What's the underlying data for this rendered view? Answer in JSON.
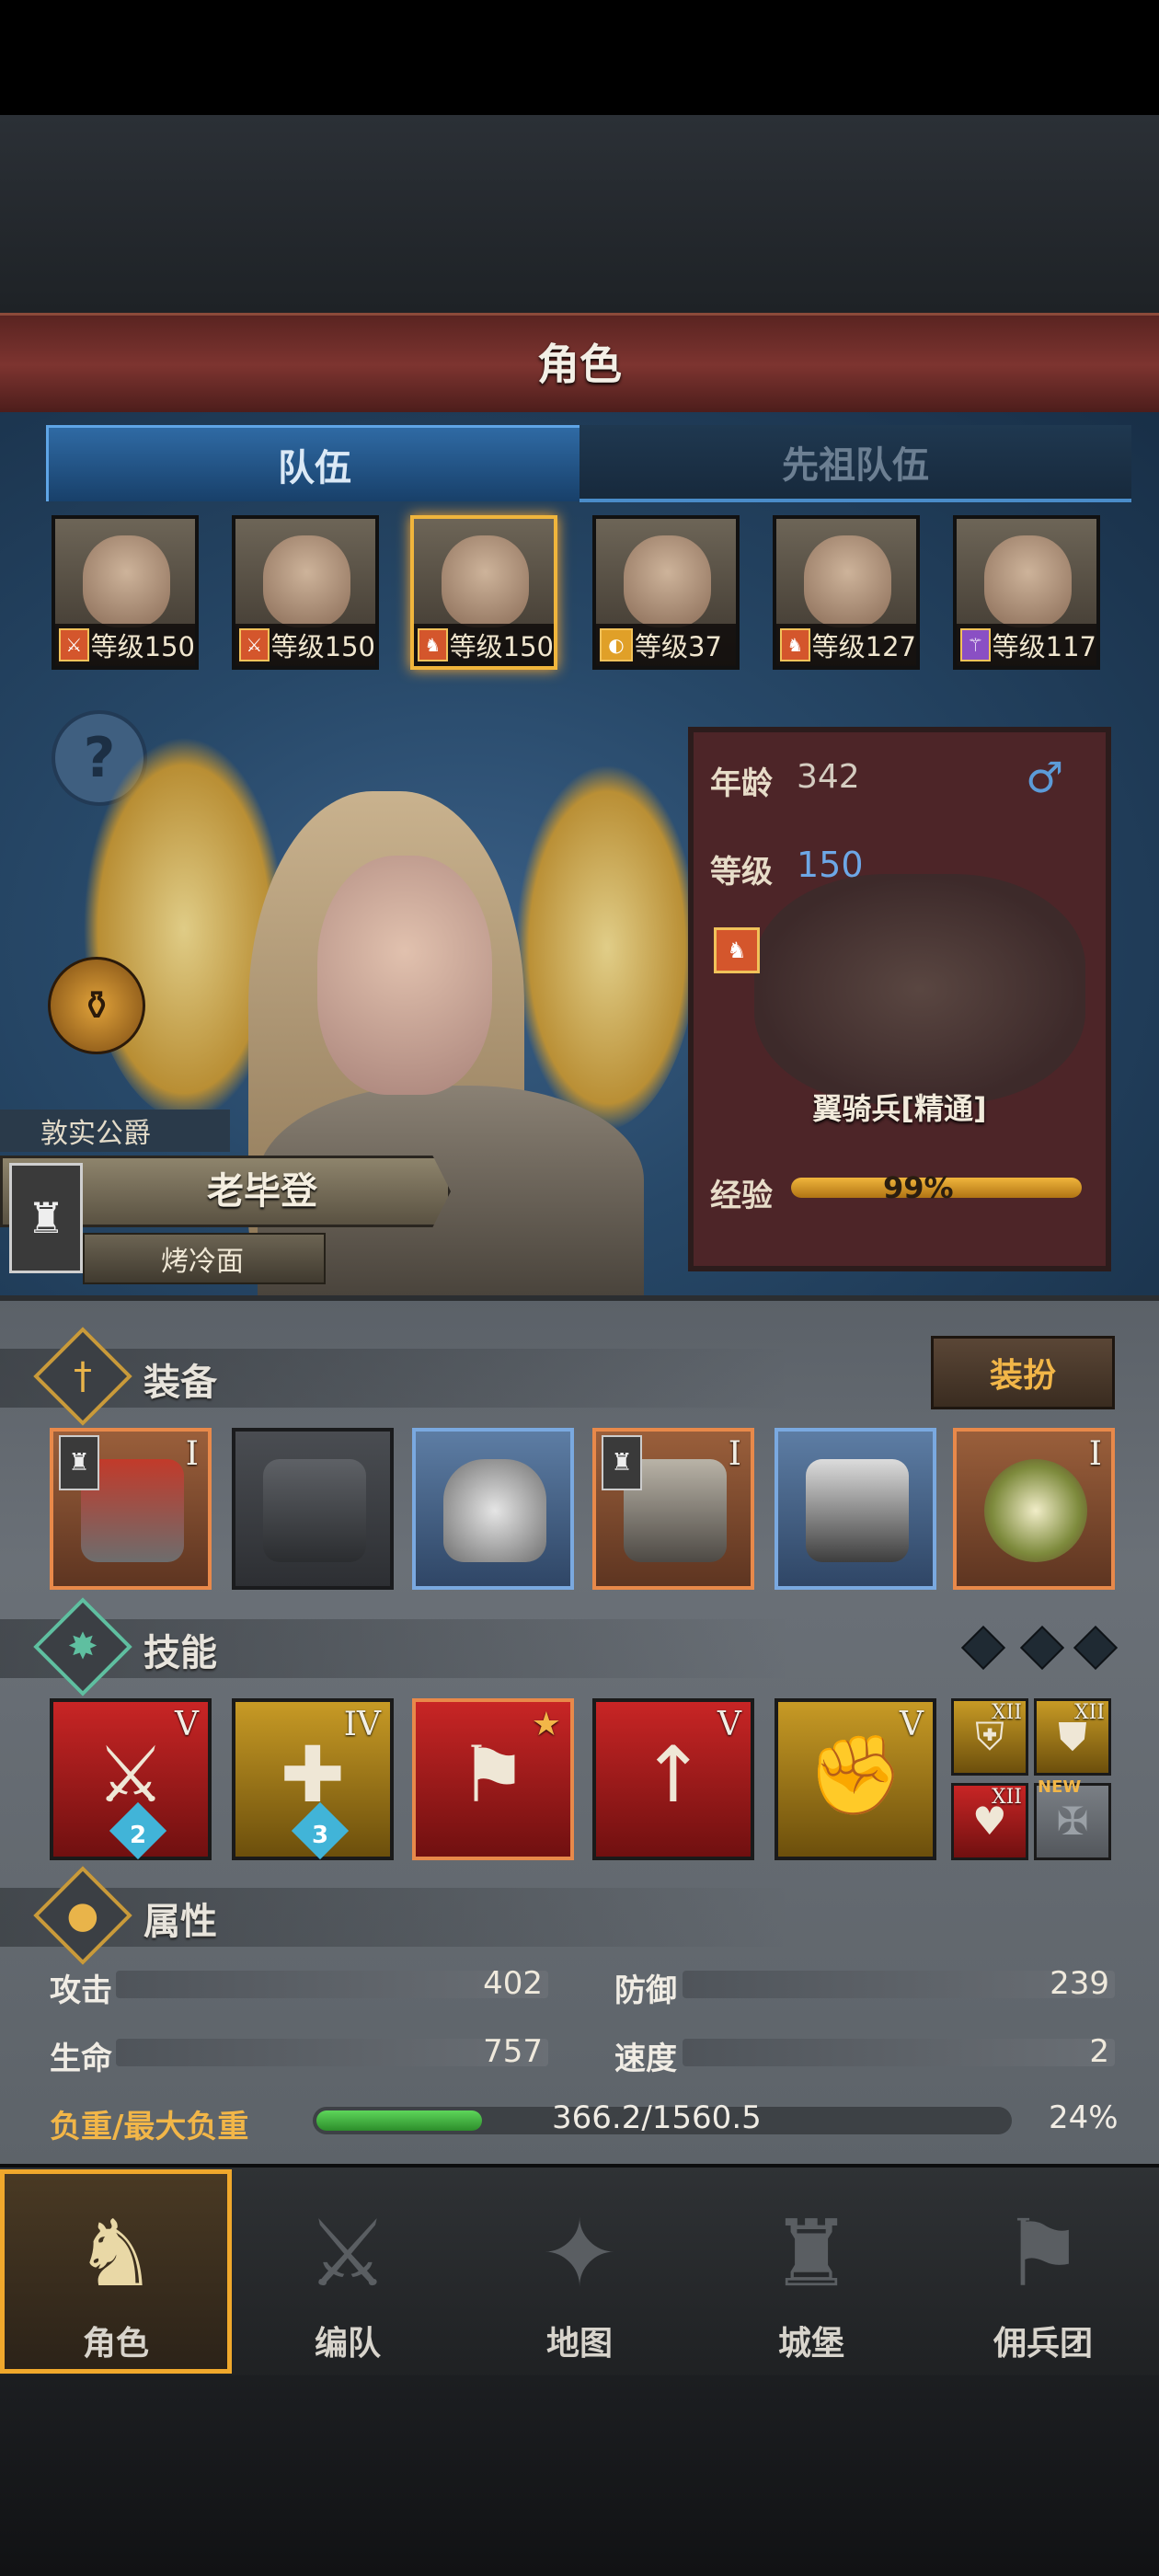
{
  "header": {
    "title": "角色"
  },
  "tabs": [
    {
      "label": "队伍"
    },
    {
      "label": "先祖队伍"
    }
  ],
  "roster": [
    {
      "level": "等级150",
      "class_icon": "sword-icon"
    },
    {
      "level": "等级150",
      "class_icon": "sword-icon"
    },
    {
      "level": "等级150",
      "class_icon": "horse-icon"
    },
    {
      "level": "等级37",
      "class_icon": "shield-icon"
    },
    {
      "level": "等级127",
      "class_icon": "horse-icon"
    },
    {
      "level": "等级117",
      "class_icon": "staff-icon"
    }
  ],
  "hero": {
    "title": "敦实公爵",
    "name": "老毕登",
    "subtitle": "烤冷面"
  },
  "info": {
    "age_label": "年龄",
    "age": "342",
    "gender": "♂",
    "level_label": "等级",
    "level": "150",
    "unit_name": "翼骑兵[精通]",
    "exp_label": "经验",
    "exp": "99%"
  },
  "sections": {
    "equipment": "装备",
    "dress_button": "装扮",
    "skills": "技能",
    "attributes": "属性"
  },
  "equipment": [
    {
      "name": "hammer",
      "rank": "I",
      "rarity": "orange"
    },
    {
      "name": "empty-banner",
      "rank": "",
      "rarity": "gray"
    },
    {
      "name": "helmet",
      "rank": "",
      "rarity": "blue"
    },
    {
      "name": "armor",
      "rank": "I",
      "rarity": "orange"
    },
    {
      "name": "boots",
      "rank": "",
      "rarity": "blue"
    },
    {
      "name": "flower-accessory",
      "rank": "I",
      "rarity": "orange"
    }
  ],
  "skills": [
    {
      "rank": "V",
      "badge": "2"
    },
    {
      "rank": "IV",
      "badge": "3"
    },
    {
      "rank": "",
      "badge": ""
    },
    {
      "rank": "V",
      "badge": ""
    },
    {
      "rank": "V",
      "badge": ""
    }
  ],
  "mini_skills": [
    {
      "rank": "XII"
    },
    {
      "rank": "XII"
    },
    {
      "rank": "XII"
    },
    {
      "tag": "NEW"
    }
  ],
  "stats": {
    "attack_label": "攻击",
    "attack": "402",
    "defense_label": "防御",
    "defense": "239",
    "hp_label": "生命",
    "hp": "757",
    "speed_label": "速度",
    "speed": "2",
    "load_label": "负重/最大负重",
    "load": "366.2/1560.5",
    "load_pct": "24%",
    "load_fraction": 0.24
  },
  "nav": [
    {
      "label": "角色"
    },
    {
      "label": "编队"
    },
    {
      "label": "地图"
    },
    {
      "label": "城堡"
    },
    {
      "label": "佣兵团"
    }
  ],
  "colors": {
    "accent": "#f2b648",
    "blue": "#6da7e6",
    "header": "#7d3430"
  }
}
